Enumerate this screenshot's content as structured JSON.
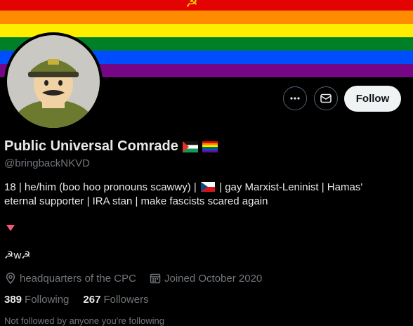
{
  "banner": {
    "stripe_colors": [
      "#e40303",
      "#ff8c00",
      "#ffed00",
      "#008026",
      "#004dff",
      "#750787"
    ]
  },
  "header": {
    "more_icon": "more-horizontal-icon",
    "message_icon": "envelope-icon",
    "follow_label": "Follow"
  },
  "profile": {
    "display_name": "Public Universal Comrade",
    "handle": "@bringbackNKVD",
    "bio_line1_a": "18 | he/him (boo hoo pronouns scawwy) |",
    "bio_line1_b": "| gay Marxist-Leninist | Hamas'",
    "bio_line2": "eternal supporter | IRA stan | make fascists scared again",
    "owo": "☭w☭",
    "location": "headquarters of the CPC",
    "joined": "Joined October 2020",
    "following_count": "389",
    "following_label": "Following",
    "followers_count": "267",
    "followers_label": "Followers",
    "followed_by": "Not followed by anyone you're following"
  }
}
